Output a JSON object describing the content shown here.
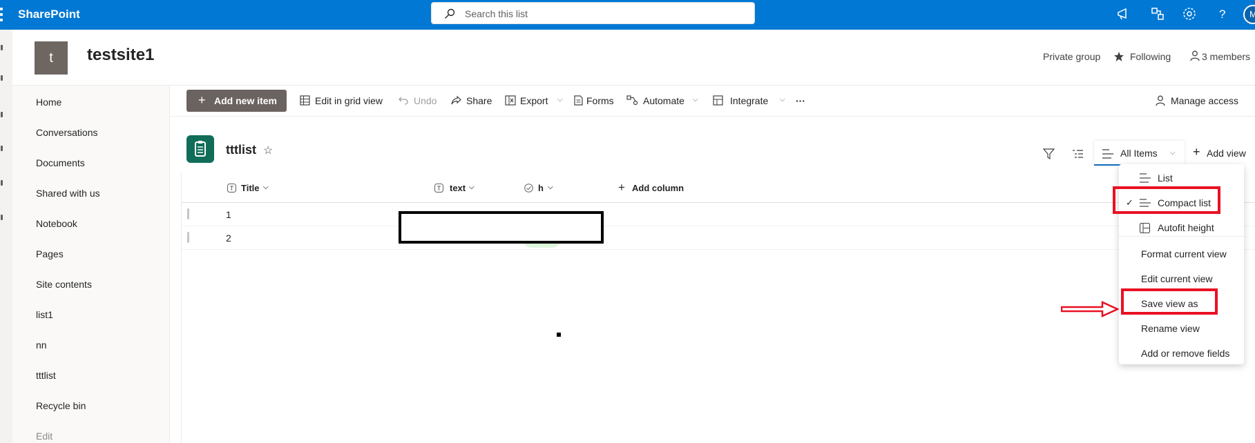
{
  "suite": {
    "brand": "SharePoint",
    "search_placeholder": "Search this list",
    "avatar_initial": "M",
    "icons": [
      "megaphone-icon",
      "share-icon",
      "settings-icon",
      "help-icon"
    ]
  },
  "site": {
    "logo_letter": "t",
    "title": "testsite1",
    "privacy": "Private group",
    "following": "Following",
    "members": "3 members"
  },
  "nav": {
    "items": [
      "Home",
      "Conversations",
      "Documents",
      "Shared with us",
      "Notebook",
      "Pages",
      "Site contents",
      "list1",
      "nn",
      "tttlist",
      "Recycle bin",
      "Edit"
    ]
  },
  "commandbar": {
    "add_new_item": "Add new item",
    "edit_grid": "Edit in grid view",
    "undo": "Undo",
    "share": "Share",
    "export": "Export",
    "forms": "Forms",
    "automate": "Automate",
    "integrate": "Integrate",
    "more": "···",
    "manage_access": "Manage access"
  },
  "list": {
    "title": "tttlist",
    "view_name": "All Items",
    "add_view": "Add view",
    "columns": [
      "Title",
      "text",
      "h"
    ],
    "add_column": "Add column",
    "rows": [
      {
        "title": "1"
      },
      {
        "title": "2"
      }
    ]
  },
  "view_menu": {
    "items": [
      "List",
      "Compact list",
      "Autofit height",
      "Format current view",
      "Edit current view",
      "Save view as",
      "Rename view",
      "Add or remove fields"
    ],
    "checked": "Compact list"
  },
  "annotations": {
    "highlight_color": "#e81123",
    "highlighted": [
      "Compact list",
      "Save view as"
    ]
  },
  "colors": {
    "suite_bar": "#0078d4",
    "primary_button": "#6b6360",
    "list_icon": "#116d58"
  }
}
